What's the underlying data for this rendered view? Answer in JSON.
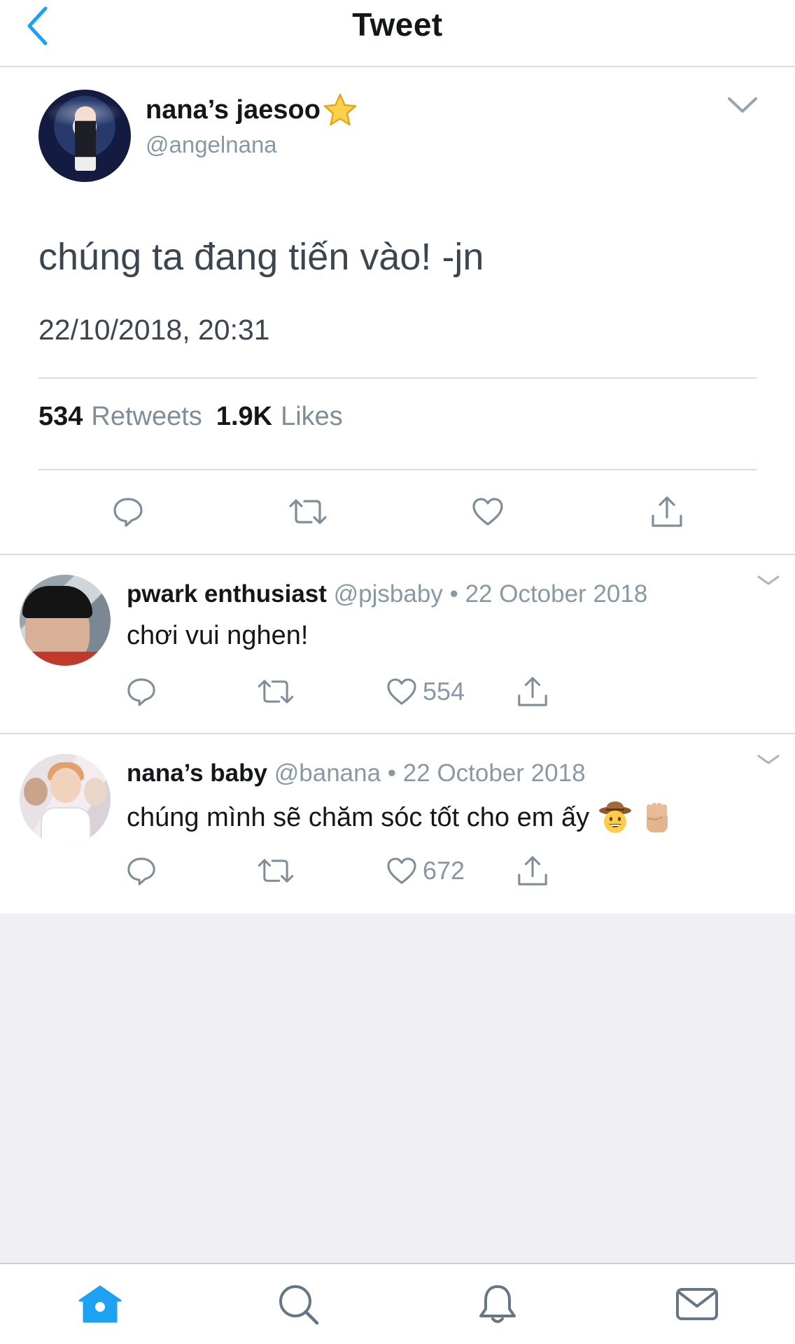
{
  "header": {
    "title": "Tweet",
    "back_icon": "chevron-left-icon"
  },
  "colors": {
    "accent": "#1da1f2",
    "text_primary": "#14171a",
    "text_secondary": "#8899a6",
    "divider": "#d8dde1",
    "empty_background": "#efeff4"
  },
  "main_tweet": {
    "author_name": "nana’s jaesoo",
    "author_badge_icon": "star-icon",
    "handle": "@angelnana",
    "text": "chúng ta đang tiến vào! -jn",
    "timestamp": "22/10/2018, 20:31",
    "retweet_count": "534",
    "retweet_label": "Retweets",
    "like_count": "1.9K",
    "like_label": "Likes",
    "actions": [
      "reply-icon",
      "retweet-icon",
      "heart-icon",
      "share-icon"
    ]
  },
  "replies": [
    {
      "name": "pwark enthusiast",
      "handle": "@pjsbaby",
      "separator": "•",
      "date": "22 October 2018",
      "text": "chơi vui nghen!",
      "like_count": "554"
    },
    {
      "name": "nana’s baby",
      "handle": "@banana",
      "separator": "•",
      "date": "22 October 2018",
      "text": "chúng mình sẽ chăm sóc tốt cho em ấy",
      "emojis": [
        "cowboy-face-emoji",
        "raised-fist-emoji"
      ],
      "like_count": "672"
    }
  ],
  "tabbar": {
    "tabs": [
      "home-icon",
      "search-icon",
      "notifications-icon",
      "messages-icon"
    ],
    "active_tab": "home-icon"
  }
}
